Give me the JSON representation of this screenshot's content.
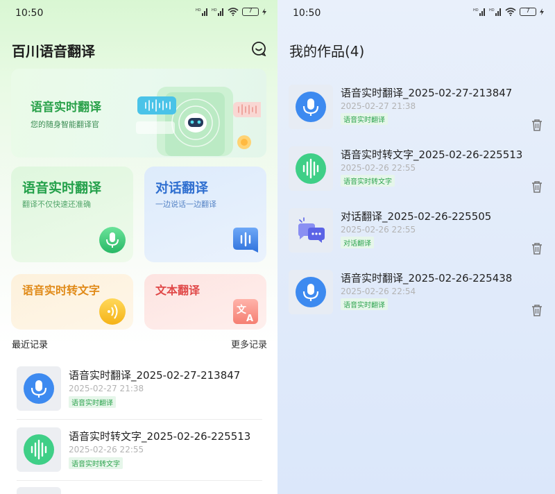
{
  "status": {
    "time": "10:50",
    "battery": "7"
  },
  "home": {
    "app_title": "百川语音翻译",
    "banner": {
      "title": "语音实时翻译",
      "subtitle": "您的随身智能翻译官"
    },
    "cards": [
      {
        "title": "语音实时翻译",
        "subtitle": "翻译不仅快速还准确",
        "icon": "microphone-icon"
      },
      {
        "title": "对话翻译",
        "subtitle": "一边说话一边翻译",
        "icon": "soundwave-bubble-icon"
      },
      {
        "title": "语音实时转文字",
        "icon": "sound-waves-icon"
      },
      {
        "title": "文本翻译",
        "icon": "translate-icon"
      }
    ],
    "recent_label": "最近记录",
    "more_label": "更多记录",
    "records": [
      {
        "title": "语音实时翻译_2025-02-27-213847",
        "date": "2025-02-27 21:38",
        "tag": "语音实时翻译",
        "icon": "microphone-icon"
      },
      {
        "title": "语音实时转文字_2025-02-26-225513",
        "date": "2025-02-26 22:55",
        "tag": "语音实时转文字",
        "icon": "soundwave-icon"
      }
    ]
  },
  "works": {
    "title": "我的作品(4)",
    "items": [
      {
        "title": "语音实时翻译_2025-02-27-213847",
        "date": "2025-02-27 21:38",
        "tag": "语音实时翻译",
        "icon": "microphone-icon"
      },
      {
        "title": "语音实时转文字_2025-02-26-225513",
        "date": "2025-02-26 22:55",
        "tag": "语音实时转文字",
        "icon": "soundwave-icon"
      },
      {
        "title": "对话翻译_2025-02-26-225505",
        "date": "2025-02-26 22:55",
        "tag": "对话翻译",
        "icon": "chat-bubbles-icon"
      },
      {
        "title": "语音实时翻译_2025-02-26-225438",
        "date": "2025-02-26 22:54",
        "tag": "语音实时翻译",
        "icon": "microphone-icon"
      }
    ]
  },
  "colors": {
    "green_accent": "#2aa14a",
    "blue_accent": "#2f6fd0",
    "orange_accent": "#e08a18",
    "red_accent": "#e04848",
    "mic_blue": "#3d8af0",
    "wave_green": "#3fcf87"
  }
}
